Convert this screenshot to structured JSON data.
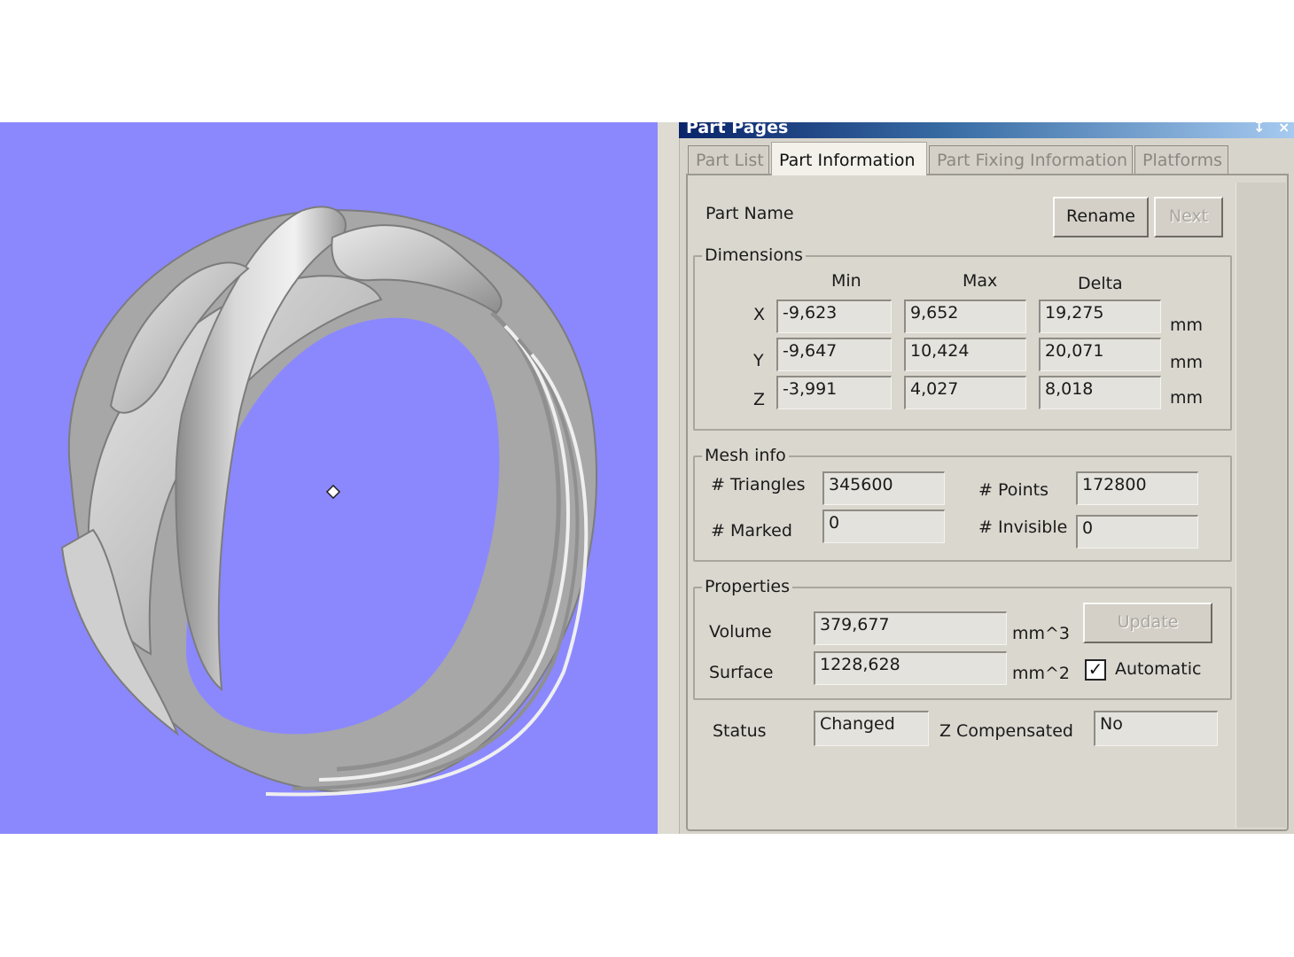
{
  "panel": {
    "title": "Part Pages",
    "pin_glyph": "↧",
    "close_glyph": "×",
    "tabs": [
      {
        "label": "Part List"
      },
      {
        "label": "Part Information"
      },
      {
        "label": "Part Fixing Information"
      },
      {
        "label": "Platforms"
      }
    ],
    "active_tab": "Part Information"
  },
  "part": {
    "name_label": "Part Name",
    "rename_label": "Rename",
    "next_label": "Next"
  },
  "dimensions": {
    "title": "Dimensions",
    "headers": {
      "min": "Min",
      "max": "Max",
      "delta": "Delta"
    },
    "rows": [
      {
        "axis": "X",
        "min": "-9,623",
        "max": "9,652",
        "delta": "19,275",
        "unit": "mm"
      },
      {
        "axis": "Y",
        "min": "-9,647",
        "max": "10,424",
        "delta": "20,071",
        "unit": "mm"
      },
      {
        "axis": "Z",
        "min": "-3,991",
        "max": "4,027",
        "delta": "8,018",
        "unit": "mm"
      }
    ]
  },
  "mesh": {
    "title": "Mesh info",
    "triangles_label": "# Triangles",
    "triangles": "345600",
    "points_label": "# Points",
    "points": "172800",
    "marked_label": "# Marked",
    "marked": "0",
    "invisible_label": "# Invisible",
    "invisible": "0"
  },
  "properties": {
    "title": "Properties",
    "volume_label": "Volume",
    "volume": "379,677",
    "volume_unit": "mm^3",
    "surface_label": "Surface",
    "surface": "1228,628",
    "surface_unit": "mm^2",
    "update_label": "Update",
    "automatic_label": "Automatic",
    "automatic_checked": true,
    "check_glyph": "✓"
  },
  "status": {
    "status_label": "Status",
    "status_value": "Changed",
    "zcomp_label": "Z Compensated",
    "zcomp_value": "No"
  },
  "colors": {
    "viewport_bg": "#8b88fe",
    "model": "#b9b9b9",
    "panel_bg": "#d7d4cc"
  }
}
